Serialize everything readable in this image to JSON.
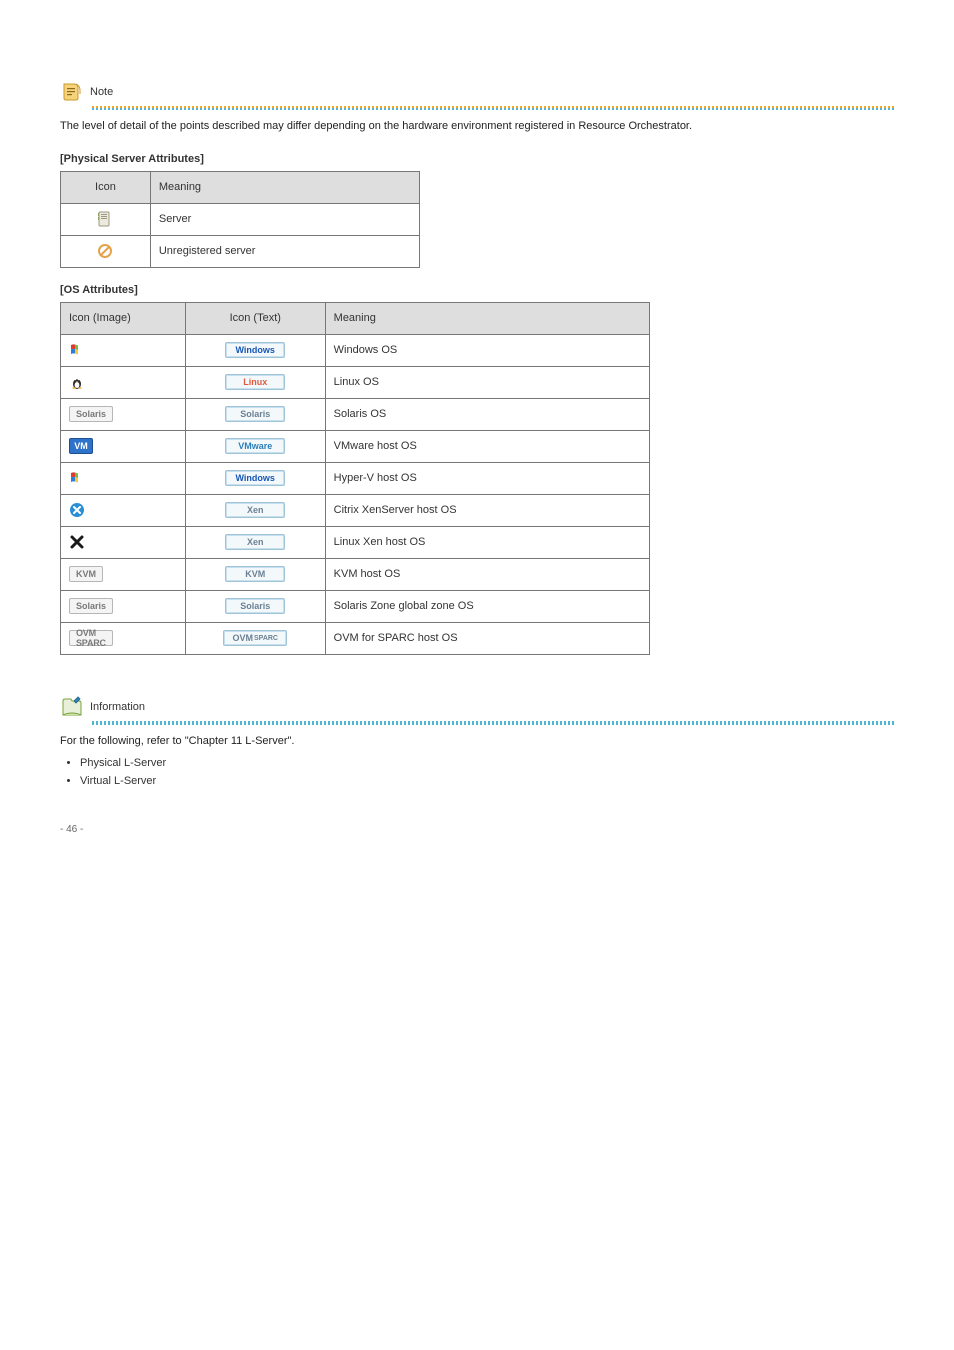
{
  "page_number": "- 46 -",
  "note": {
    "label": "Note",
    "text": "The level of detail of the points described may differ depending on the hardware environment registered in Resource Orchestrator."
  },
  "info": {
    "label": "Information",
    "text_before": "For the following, refer to \"",
    "link_text": "Chapter 11 L-Server",
    "text_after": "\"."
  },
  "bullets": [
    "Physical L-Server",
    "Virtual L-Server"
  ],
  "section1_label": "[Physical Server Attributes]",
  "table1": {
    "headers": [
      "Icon",
      "Meaning"
    ],
    "rows": [
      {
        "icon_name": "server-icon",
        "meaning": "Server"
      },
      {
        "icon_name": "unregistered-server-icon",
        "meaning": "Unregistered server"
      }
    ]
  },
  "section2_label": "[OS Attributes]",
  "table2": {
    "headers": [
      "Icon (Image)",
      "Icon (Text)",
      "Meaning"
    ],
    "rows": [
      {
        "img": "windows-flag-icon",
        "txt": "Windows",
        "txt_class": "win",
        "meaning": "Windows OS"
      },
      {
        "img": "linux-penguin-icon",
        "txt": "Linux",
        "txt_class": "linux",
        "meaning": "Linux OS"
      },
      {
        "img": "solaris-badge-icon",
        "img_label": "Solaris",
        "txt": "Solaris",
        "txt_class": "solaris",
        "meaning": "Solaris OS"
      },
      {
        "img": "vmware-badge-icon",
        "img_label": "VM",
        "txt": "VMware",
        "txt_class": "vmware",
        "meaning": "VMware host OS"
      },
      {
        "img": "windows-flag-vm-icon",
        "txt": "Windows",
        "txt_class": "win",
        "meaning": "Hyper-V host OS"
      },
      {
        "img": "xen-circle-icon",
        "txt": "Xen",
        "txt_class": "xen",
        "meaning": "Citrix XenServer host OS"
      },
      {
        "img": "xen-x-icon",
        "txt": "Xen",
        "txt_class": "xen",
        "meaning": "Linux Xen host OS"
      },
      {
        "img": "kvm-badge-icon",
        "img_label": "KVM",
        "txt": "KVM",
        "txt_class": "kvm",
        "meaning": "KVM host OS"
      },
      {
        "img": "solaris-badge-icon",
        "img_label": "Solaris",
        "txt": "Solaris",
        "txt_class": "solaris",
        "meaning": "Solaris Zone global zone OS"
      },
      {
        "img": "ovmsparc-badge-icon",
        "img_label": "OVM SPARC",
        "txt": "OVMSPARC",
        "txt_class": "ovmsparc",
        "meaning": "OVM for SPARC host OS"
      }
    ]
  }
}
